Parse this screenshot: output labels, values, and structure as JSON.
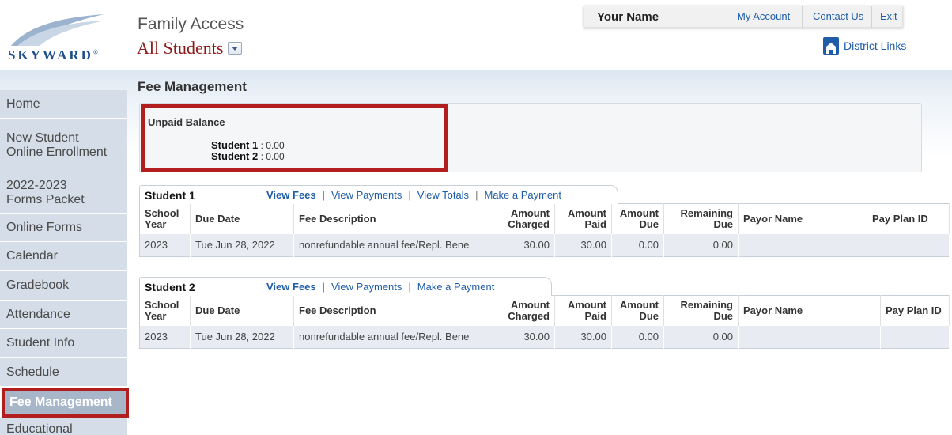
{
  "header": {
    "logo_text": "SKYWARD",
    "app_title": "Family Access",
    "student_selector": "All Students",
    "user_name": "Your Name",
    "links": [
      "My Account",
      "Contact Us",
      "Exit"
    ],
    "district_links": "District Links"
  },
  "sidebar": {
    "items": [
      {
        "label": "Home"
      },
      {
        "label": "New Student Online Enrollment"
      },
      {
        "label": "2022-2023 Forms Packet"
      },
      {
        "label": "Online Forms"
      },
      {
        "label": "Calendar"
      },
      {
        "label": "Gradebook"
      },
      {
        "label": "Attendance"
      },
      {
        "label": "Student Info"
      },
      {
        "label": "Schedule"
      },
      {
        "label": "Fee Management"
      },
      {
        "label": "Educational"
      }
    ],
    "active": "Fee Management"
  },
  "page": {
    "title": "Fee Management"
  },
  "balance": {
    "title": "Unpaid Balance",
    "rows": [
      {
        "student": "Student 1",
        "sep": ":",
        "amount": "0.00"
      },
      {
        "student": "Student 2",
        "sep": ":",
        "amount": "0.00"
      }
    ]
  },
  "fees": [
    {
      "student": "Student 1",
      "links": [
        "View Fees",
        "View Payments",
        "View Totals",
        "Make a Payment"
      ],
      "columns": [
        "School Year",
        "Due Date",
        "Fee Description",
        "Amount Charged",
        "Amount Paid",
        "Amount Due",
        "Remaining Due",
        "Payor Name",
        "Pay Plan ID"
      ],
      "rows": [
        [
          "2023",
          "Tue Jun 28, 2022",
          "nonrefundable annual fee/Repl. Bene",
          "30.00",
          "30.00",
          "0.00",
          "0.00",
          "",
          ""
        ]
      ]
    },
    {
      "student": "Student 2",
      "links": [
        "View Fees",
        "View Payments",
        "Make a Payment"
      ],
      "columns": [
        "School Year",
        "Due Date",
        "Fee Description",
        "Amount Charged",
        "Amount Paid",
        "Amount Due",
        "Remaining Due",
        "Payor Name",
        "Pay Plan ID"
      ],
      "rows": [
        [
          "2023",
          "Tue Jun 28, 2022",
          "nonrefundable annual fee/Repl. Bene",
          "30.00",
          "30.00",
          "0.00",
          "0.00",
          "",
          ""
        ]
      ]
    }
  ],
  "colors": {
    "accent_red": "#b21e1e",
    "link_blue": "#1f5da8",
    "brand_blue": "#1f4e8c",
    "selector_red": "#8b1a1a",
    "nav_bg": "#d4dde8"
  }
}
